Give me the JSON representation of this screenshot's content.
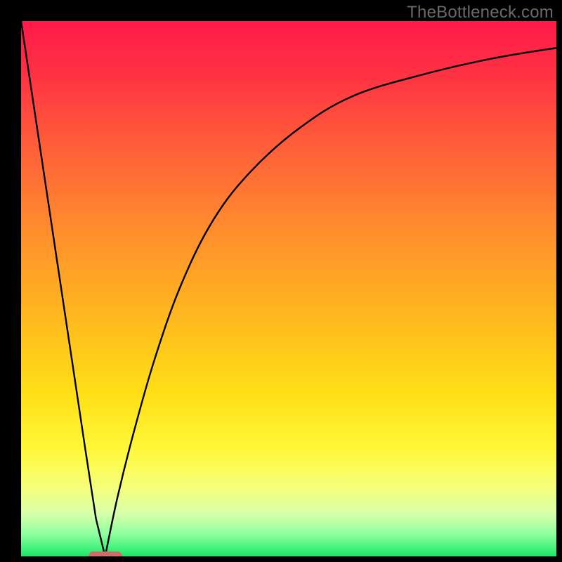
{
  "watermark": "TheBottleneck.com",
  "colors": {
    "frame": "#000000",
    "curve": "#000000",
    "pill": "#d46a6a",
    "gradient_top": "#ff1a4a",
    "gradient_bottom": "#17e868"
  },
  "chart_data": {
    "type": "line",
    "title": "",
    "xlabel": "",
    "ylabel": "",
    "xlim": [
      0,
      100
    ],
    "ylim": [
      0,
      100
    ],
    "grid": false,
    "legend": false,
    "minimum": {
      "x": 15.7,
      "y": 0
    },
    "series": [
      {
        "name": "left-branch",
        "x": [
          0,
          3,
          6,
          9,
          12,
          14,
          15.7
        ],
        "values": [
          100,
          80,
          60,
          40,
          20,
          7,
          0
        ]
      },
      {
        "name": "right-branch",
        "x": [
          15.7,
          18,
          21,
          25,
          30,
          36,
          43,
          52,
          62,
          75,
          88,
          100
        ],
        "values": [
          0,
          11,
          23,
          37,
          51,
          63,
          72,
          80,
          86,
          90,
          93,
          95
        ]
      }
    ],
    "background_gradient": {
      "direction": "top-to-bottom",
      "stops": [
        {
          "pos": 0.0,
          "color": "#ff1a4a"
        },
        {
          "pos": 0.22,
          "color": "#ff5a3a"
        },
        {
          "pos": 0.55,
          "color": "#ffb81f"
        },
        {
          "pos": 0.8,
          "color": "#fff83a"
        },
        {
          "pos": 0.96,
          "color": "#8aff9e"
        },
        {
          "pos": 1.0,
          "color": "#17e868"
        }
      ]
    }
  }
}
